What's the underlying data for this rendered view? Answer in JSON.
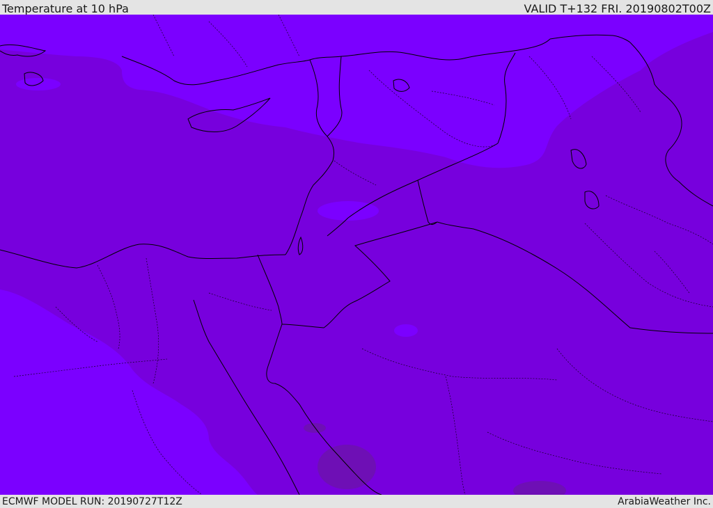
{
  "header": {
    "title": "Temperature at 10 hPa",
    "valid_time": "VALID T+132 FRI. 20190802T00Z"
  },
  "footer": {
    "model_run": "ECMWF MODEL RUN: 20190727T12Z",
    "credit": "ArabiaWeather Inc."
  },
  "colors": {
    "warm_band": "#7700dd",
    "cool_band": "#7b00ff",
    "patch_dark": "#6e0fb5",
    "border_line": "#000000",
    "frame_bg": "#e4e4e4"
  }
}
